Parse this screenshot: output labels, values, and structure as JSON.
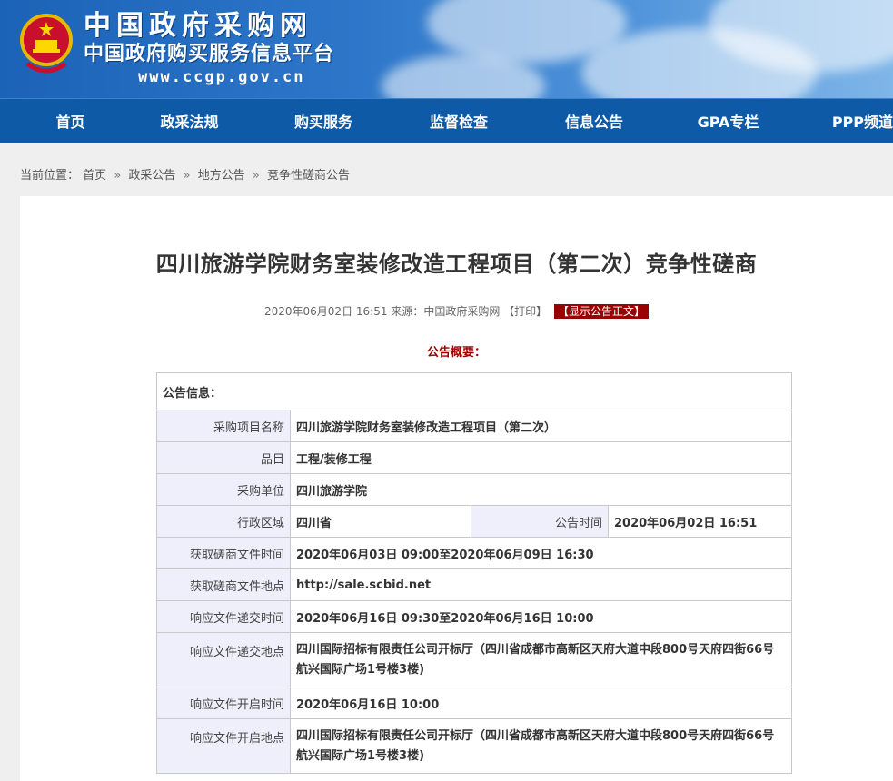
{
  "header": {
    "title_cn": "中国政府采购网",
    "subtitle_cn": "中国政府购买服务信息平台",
    "url": "www.ccgp.gov.cn"
  },
  "nav": {
    "items": [
      "首页",
      "政采法规",
      "购买服务",
      "监督检查",
      "信息公告",
      "GPA专栏",
      "PPP频道"
    ]
  },
  "breadcrumb": {
    "prefix": "当前位置：",
    "items": [
      "首页",
      "政采公告",
      "地方公告",
      "竞争性磋商公告"
    ],
    "separator": "»"
  },
  "article": {
    "title": "四川旅游学院财务室装修改造工程项目（第二次）竞争性磋商",
    "meta_date": "2020年06月02日 16:51",
    "meta_source_label": "来源：",
    "meta_source": "中国政府采购网",
    "print_label": "【打印】",
    "show_body_label": "【显示公告正文】",
    "summary_label": "公告概要："
  },
  "info": {
    "header": "公告信息：",
    "project_name_label": "采购项目名称",
    "project_name": "四川旅游学院财务室装修改造工程项目（第二次）",
    "category_label": "品目",
    "category": "工程/装修工程",
    "buyer_label": "采购单位",
    "buyer": "四川旅游学院",
    "region_label": "行政区域",
    "region": "四川省",
    "notice_time_label": "公告时间",
    "notice_time": "2020年06月02日 16:51",
    "get_doc_time_label": "获取磋商文件时间",
    "get_doc_time": "2020年06月03日 09:00至2020年06月09日 16:30",
    "get_doc_place_label": "获取磋商文件地点",
    "get_doc_place": "http://sale.scbid.net",
    "submit_time_label": "响应文件递交时间",
    "submit_time": "2020年06月16日 09:30至2020年06月16日 10:00",
    "submit_place_label": "响应文件递交地点",
    "submit_place": "四川国际招标有限责任公司开标厅（四川省成都市高新区天府大道中段800号天府四街66号航兴国际广场1号楼3楼)",
    "open_time_label": "响应文件开启时间",
    "open_time": "2020年06月16日 10:00",
    "open_place_label": "响应文件开启地点",
    "open_place": "四川国际招标有限责任公司开标厅（四川省成都市高新区天府大道中段800号天府四街66号航兴国际广场1号楼3楼)"
  },
  "colors": {
    "nav_bg": "#0e5aa7",
    "accent_red": "#990000",
    "label_bg": "#eeeffa"
  }
}
